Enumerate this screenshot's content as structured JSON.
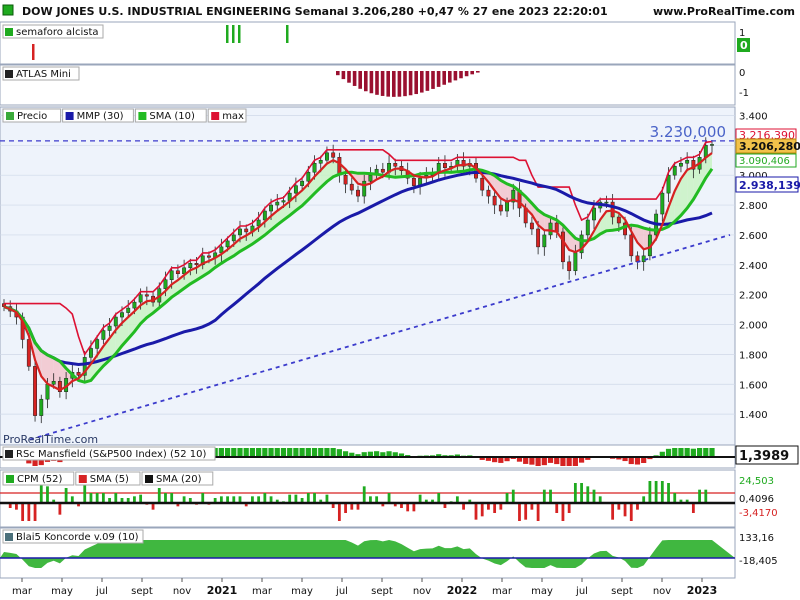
{
  "header": {
    "title": "DOW JONES U.S. INDUSTRIAL ENGINEERING Semanal 3.206,280 +0,47 % 27 ene 2023 22:20:01",
    "site": "www.ProRealTime.com",
    "watermark": "ProRealTime.com"
  },
  "panels": {
    "semaforo": {
      "label": "semaforo alcista",
      "value": "0",
      "axis": [
        "1",
        "0"
      ]
    },
    "atlas": {
      "label": "ATLAS Mini",
      "axis": [
        "0",
        "-1"
      ]
    },
    "price": {
      "legend": [
        "Precio",
        "MMP (30)",
        "SMA (10)",
        "max"
      ],
      "level_label": "3.230,000",
      "badges": {
        "max": "3.216,390",
        "price": "3.206,280",
        "sma": "3.090,406",
        "mmp": "2.938,139"
      }
    },
    "rsc": {
      "label": "RSc Mansfield (S&P500 Index) (52 10)",
      "value": "1,3989"
    },
    "cpm": {
      "legend": [
        "CPM (52)",
        "SMA (5)",
        "SMA (20)"
      ],
      "values": [
        "24,503",
        "0,4096",
        "-3,4170"
      ]
    },
    "koncorde": {
      "label": "Blai5 Koncorde v.09 (10)",
      "values": [
        "133,16",
        "-18,405"
      ]
    }
  },
  "colors": {
    "up": "#1faa1f",
    "down": "#d62222",
    "mmp": "#1a1aa8",
    "sma": "#22bb22",
    "max": "#dd1133",
    "grid": "#cfd8e8",
    "bg": "#eef3fb",
    "dash": "#3b3bcc"
  },
  "chart_data": {
    "type": "candlestick",
    "title": "DOW JONES U.S. INDUSTRIAL ENGINEERING Semanal 3.206,280 +0,47 % 27 ene 2023 22:20:01",
    "ylim": [
      1200,
      3450
    ],
    "y_ticks": [
      "3.400",
      "3.200",
      "3.000",
      "2.800",
      "2.600",
      "2.400",
      "2.200",
      "2.000",
      "1.800",
      "1.600",
      "1.400"
    ],
    "x_ticks": [
      "mar",
      "may",
      "jul",
      "sept",
      "nov",
      "2021",
      "mar",
      "may",
      "jul",
      "sept",
      "nov",
      "2022",
      "mar",
      "may",
      "jul",
      "sept",
      "nov",
      "2023"
    ],
    "resistance_level": 3230,
    "trendline": {
      "from": {
        "x": "mar 2020",
        "y": 1230
      },
      "to": {
        "x": "ene 2023",
        "y": 2600
      }
    },
    "close": [
      2120,
      2090,
      2050,
      1900,
      1720,
      1390,
      1500,
      1600,
      1620,
      1550,
      1640,
      1680,
      1660,
      1780,
      1840,
      1900,
      1960,
      1990,
      2050,
      2080,
      2110,
      2150,
      2200,
      2190,
      2150,
      2240,
      2300,
      2360,
      2340,
      2380,
      2410,
      2400,
      2460,
      2450,
      2480,
      2520,
      2560,
      2600,
      2640,
      2620,
      2660,
      2700,
      2760,
      2800,
      2820,
      2830,
      2880,
      2930,
      2960,
      3020,
      3080,
      3100,
      3150,
      3120,
      3000,
      2940,
      2900,
      2860,
      2960,
      3000,
      3040,
      3020,
      3080,
      3060,
      3030,
      2980,
      2930,
      2980,
      3000,
      3020,
      3080,
      3050,
      3060,
      3100,
      3060,
      3080,
      2980,
      2900,
      2860,
      2800,
      2760,
      2820,
      2900,
      2780,
      2680,
      2640,
      2520,
      2600,
      2680,
      2620,
      2420,
      2360,
      2480,
      2600,
      2700,
      2780,
      2820,
      2820,
      2720,
      2680,
      2600,
      2460,
      2420,
      2460,
      2600,
      2740,
      2880,
      3000,
      3060,
      3080,
      3100,
      3040,
      3120,
      3200,
      3206
    ]
  }
}
